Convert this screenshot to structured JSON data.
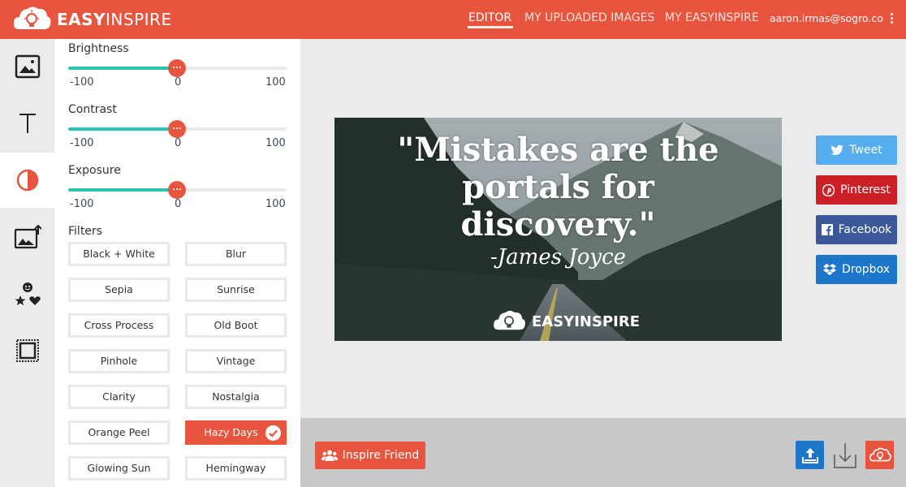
{
  "app": {
    "brand_bold": "EASY",
    "brand_rest": "INSPIRE",
    "accent_color": "#e8553e"
  },
  "nav": {
    "editor": "EDITOR",
    "uploaded": "MY UPLOADED IMAGES",
    "mine": "MY EASYINSPIRE",
    "user_email": "aaron.irmas@sogro.co"
  },
  "rail": {
    "items": [
      {
        "icon": "image-icon"
      },
      {
        "icon": "text-icon"
      },
      {
        "icon": "contrast-icon",
        "active": true
      },
      {
        "icon": "image-upload-icon"
      },
      {
        "icon": "stickers-icon"
      },
      {
        "icon": "frame-icon"
      }
    ]
  },
  "adjustments": {
    "brightness": {
      "label": "Brightness",
      "min": "-100",
      "value": "0",
      "max": "100",
      "knob": "..."
    },
    "contrast": {
      "label": "Contrast",
      "min": "-100",
      "value": "0",
      "max": "100",
      "knob": "..."
    },
    "exposure": {
      "label": "Exposure",
      "min": "-100",
      "value": "0",
      "max": "100",
      "knob": "..."
    }
  },
  "filters": {
    "title": "Filters",
    "items": [
      "Black + White",
      "Blur",
      "Sepia",
      "Sunrise",
      "Cross Process",
      "Old Boot",
      "Pinhole",
      "Vintage",
      "Clarity",
      "Nostalgia",
      "Orange Peel",
      "Hazy Days",
      "Glowing Sun",
      "Hemingway"
    ],
    "selected": "Hazy Days"
  },
  "quote": {
    "line1": "\"Mistakes are the",
    "line2": "portals for",
    "line3": "discovery.\"",
    "author": "-James Joyce",
    "brand": "EASYINSPIRE"
  },
  "share": {
    "tweet": "Tweet",
    "pinterest": "Pinterest",
    "facebook": "Facebook",
    "dropbox": "Dropbox",
    "colors": {
      "tweet": "#55acee",
      "pinterest": "#cb2027",
      "facebook": "#3b5998",
      "dropbox": "#1d76c9"
    }
  },
  "bottom": {
    "inspire_friend": "Inspire Friend"
  }
}
